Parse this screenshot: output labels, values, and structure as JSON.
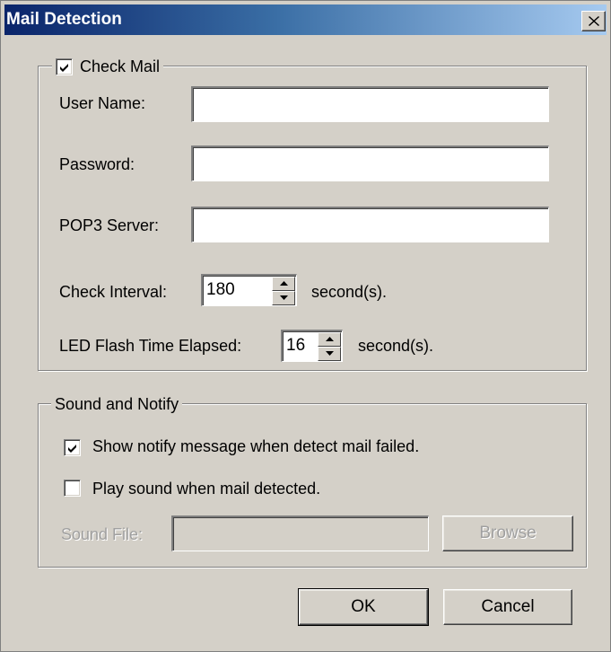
{
  "window": {
    "title": "Mail Detection",
    "close_label": "close"
  },
  "check_mail": {
    "label": "Check Mail",
    "checked": true,
    "user_name_label": "User Name:",
    "user_name_value": "",
    "password_label": "Password:",
    "password_value": "",
    "pop3_label": "POP3 Server:",
    "pop3_value": "",
    "interval_label": "Check Interval:",
    "interval_value": "180",
    "interval_unit": "second(s).",
    "led_label": "LED Flash Time Elapsed:",
    "led_value": "16",
    "led_unit": "second(s)."
  },
  "sound_notify": {
    "label": "Sound and Notify",
    "show_notify_label": "Show notify message when detect mail failed.",
    "show_notify_checked": true,
    "play_sound_label": "Play sound when mail detected.",
    "play_sound_checked": false,
    "sound_file_label": "Sound File:",
    "sound_file_value": "",
    "browse_label": "Browse"
  },
  "buttons": {
    "ok_label": "OK",
    "cancel_label": "Cancel"
  },
  "colors": {
    "face": "#d4d0c8",
    "title_start": "#0a246a",
    "title_end": "#a6caf0"
  }
}
